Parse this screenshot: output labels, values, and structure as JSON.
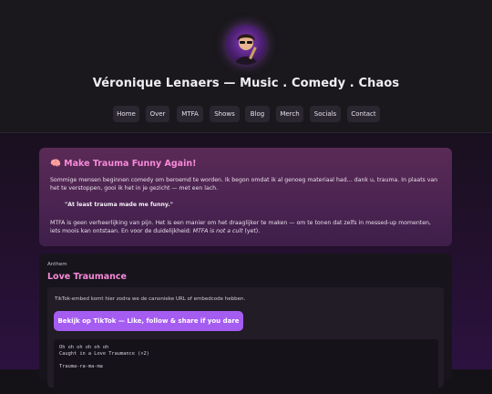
{
  "header": {
    "avatar_alt": "avatar",
    "title": "Véronique Lenaers — Music . Comedy . Chaos"
  },
  "nav": [
    "Home",
    "Over",
    "MTFA",
    "Shows",
    "Blog",
    "Merch",
    "Socials",
    "Contact"
  ],
  "trauma_card": {
    "heading": "🧠 Make Trauma Funny Again!",
    "paragraph1": "Sommige mensen beginnen comedy om beroemd te worden. Ik begon omdat ik al genoeg materiaal had… dank u, trauma. In plaats van het te verstoppen, gooi ik het in je gezicht — met een lach.",
    "quote": "\"At least trauma made me funny.\"",
    "paragraph2_main": "MTFA is geen verheerlijking van pijn. Het is een manier om het draaglijker te maken — om te tonen dat zelfs in messed-up momenten, iets moois kan ontstaan. En voor de duidelijkheid:",
    "paragraph2_em": "MTFA is not a cult",
    "paragraph2_end": "(yet)."
  },
  "anthem_card": {
    "kicker": "Anthem",
    "title": "Love Traumance",
    "embed_note": "TikTok-embed komt hier zodra we de canonieke URL of embedcode hebben.",
    "button_label": "Bekijk op TikTok — Like, follow & share if you dare",
    "lyrics": [
      "Oh oh oh oh oh oh",
      "Caught in a Love Traumance (×2)",
      "",
      "Trauma-ra-ma-ma"
    ]
  },
  "colors": {
    "accent_pink": "#f68ad9",
    "button_purple": "#a55cf1",
    "card_purple": "#4c2452"
  }
}
